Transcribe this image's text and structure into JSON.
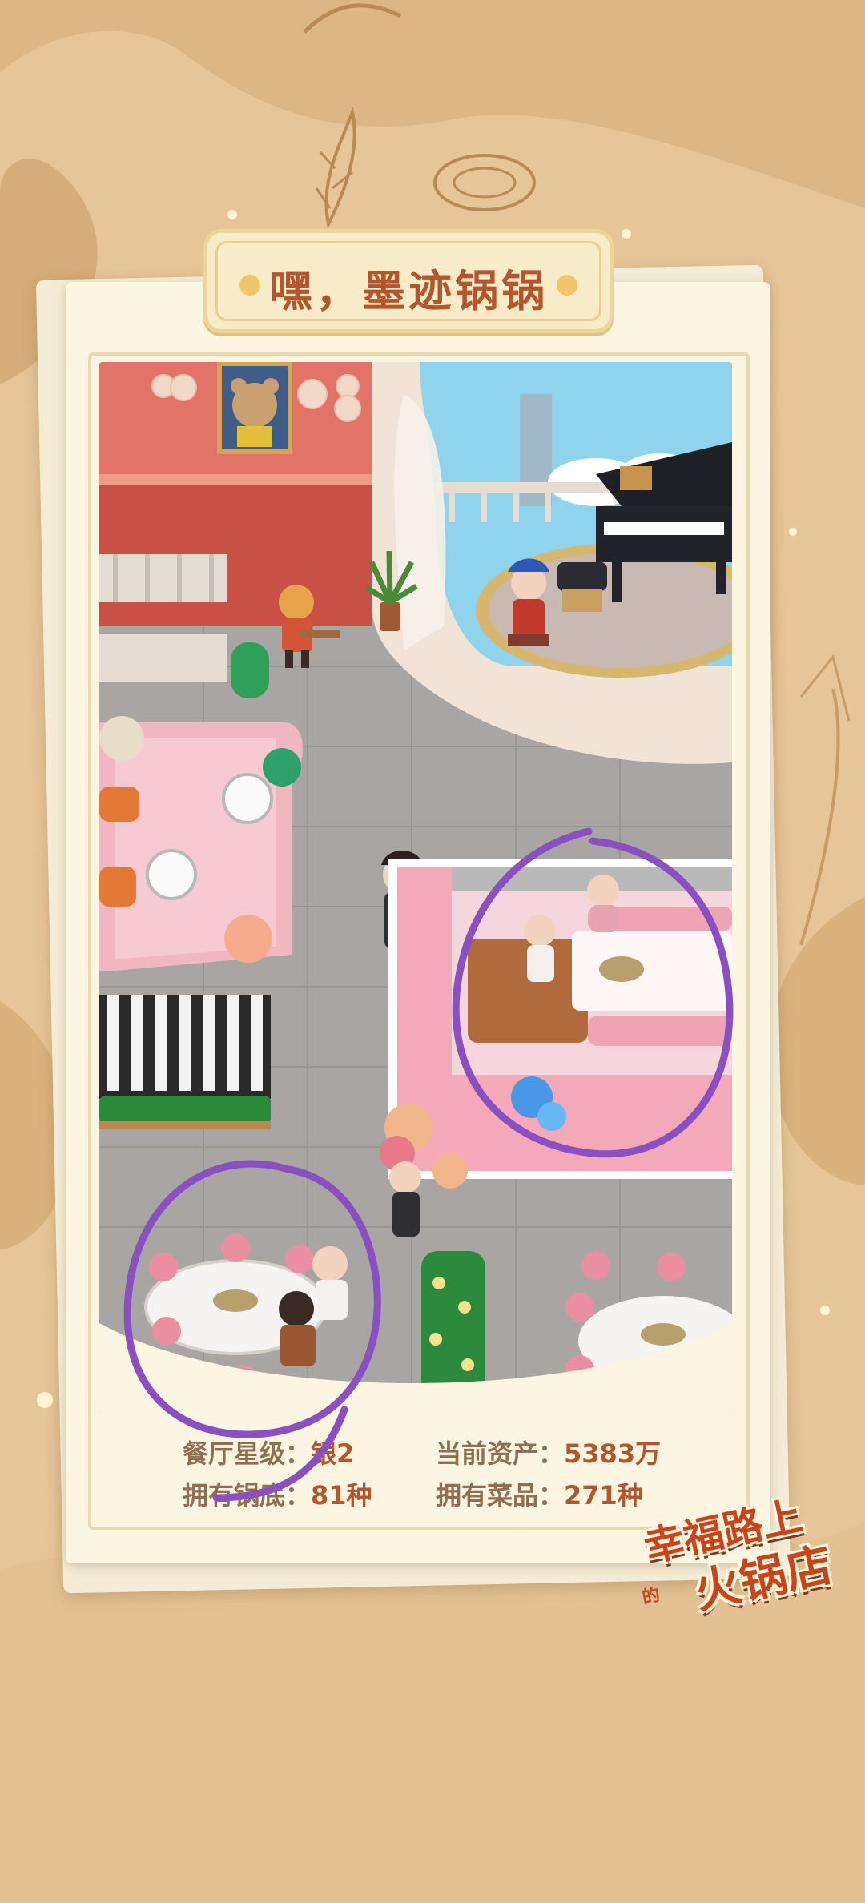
{
  "colors": {
    "background": "#e6c598",
    "card": "#fbf5e2",
    "title_text": "#b3562e",
    "stat_label": "#8f6f52",
    "stat_value": "#b3562e",
    "annotation_circle": "#8a4fc0"
  },
  "header": {
    "title": "嘿，墨迹锅锅"
  },
  "stats": {
    "star_label": "餐厅星级：",
    "star_value": "银2",
    "assets_label": "当前资产：",
    "assets_value": "5383万",
    "pots_label": "拥有锅底：",
    "pots_value": "81种",
    "dishes_label": "拥有菜品：",
    "dishes_value": "271种"
  },
  "logo": {
    "line1": "幸福路上",
    "line_small": "的",
    "line2": "火锅店"
  },
  "scene": {
    "description_icons": [
      "bear-portrait-icon",
      "piano-icon",
      "opera-performer-icon",
      "tiger-waiter-icon",
      "waiter-icon",
      "hostess-icon",
      "customer-icon",
      "hotpot-table-icon",
      "plant-icon",
      "sofa-icon"
    ]
  }
}
